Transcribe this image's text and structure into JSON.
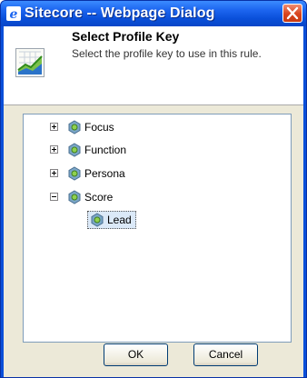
{
  "window": {
    "title": "Sitecore -- Webpage Dialog",
    "title_icon": "ie-icon",
    "close_icon": "close-icon"
  },
  "header": {
    "title": "Select Profile Key",
    "description": "Select the profile key to use in this rule.",
    "icon": "chart-icon"
  },
  "tree": {
    "items": [
      {
        "label": "Focus",
        "expanded": false,
        "icon": "profile-key-icon"
      },
      {
        "label": "Function",
        "expanded": false,
        "icon": "profile-key-icon"
      },
      {
        "label": "Persona",
        "expanded": false,
        "icon": "profile-key-icon"
      },
      {
        "label": "Score",
        "expanded": true,
        "icon": "profile-key-icon",
        "children": [
          {
            "label": "Lead",
            "selected": true,
            "icon": "profile-key-icon"
          }
        ]
      }
    ]
  },
  "buttons": {
    "ok": "OK",
    "cancel": "Cancel"
  },
  "colors": {
    "titlebar": "#0a4fd9",
    "close_button": "#d8431d",
    "dialog_background": "#ece9d8",
    "selection": "#dbe9f8"
  }
}
